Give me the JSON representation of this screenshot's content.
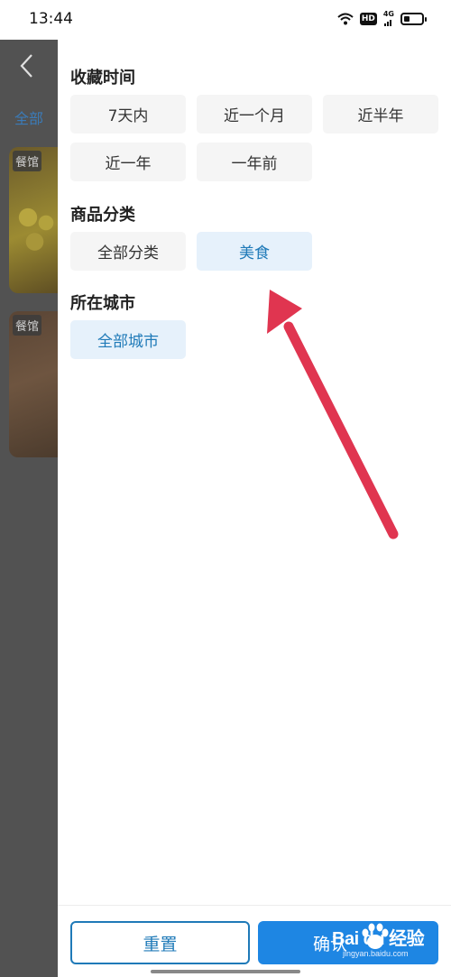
{
  "status_bar": {
    "time": "13:44",
    "hd": "HD",
    "network": "4G"
  },
  "background": {
    "tab_label": "全部",
    "cards": [
      {
        "badge": "餐馆"
      },
      {
        "badge": "餐馆"
      }
    ]
  },
  "filters": {
    "time_section": {
      "title": "收藏时间",
      "options": [
        "7天内",
        "近一个月",
        "近半年",
        "近一年",
        "一年前"
      ]
    },
    "category_section": {
      "title": "商品分类",
      "options": [
        "全部分类",
        "美食"
      ],
      "selected": "美食"
    },
    "city_section": {
      "title": "所在城市",
      "options": [
        "全部城市"
      ],
      "selected": "全部城市"
    }
  },
  "actions": {
    "reset_label": "重置",
    "confirm_label": "确认"
  },
  "watermark": {
    "logo_text": "Bai du 经验",
    "sub_text": "jingyan.baidu.com"
  },
  "colors": {
    "accent": "#1f7ab8",
    "confirm_bg": "#1e86e3",
    "chip_bg": "#f5f5f5",
    "chip_selected_bg": "#e6f1fb",
    "annotation_arrow": "#e03550"
  },
  "icons": {
    "back": "chevron-left-icon",
    "wifi": "wifi-icon",
    "signal": "signal-icon",
    "battery": "battery-icon"
  }
}
